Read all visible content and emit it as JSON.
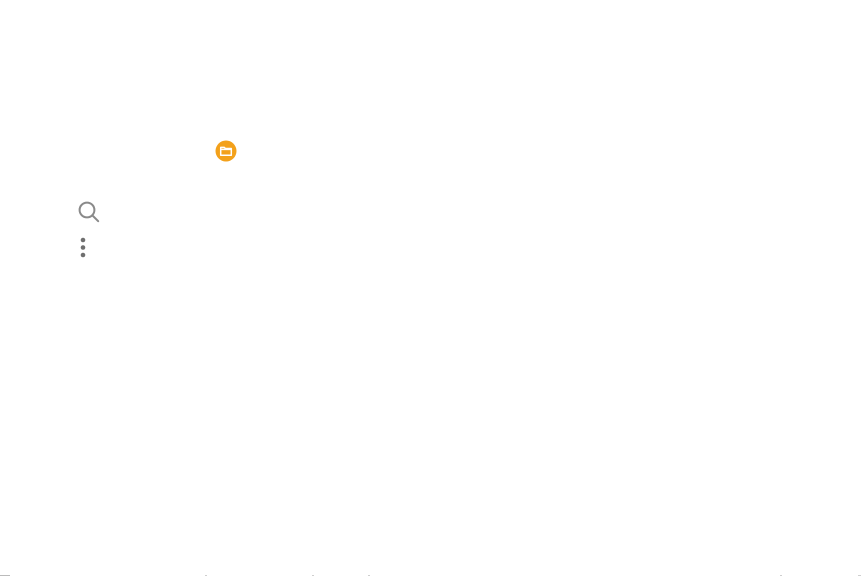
{
  "icons": {
    "app": "my-files-folder-icon",
    "search": "search-icon",
    "more": "more-options-vertical-icon"
  },
  "colors": {
    "background": "#ffffff",
    "app_icon_fill": "#F3A11B",
    "app_icon_glyph": "#ffffff",
    "icon_gray": "#8a8a8a",
    "icon_dark": "#6f6f6f"
  }
}
